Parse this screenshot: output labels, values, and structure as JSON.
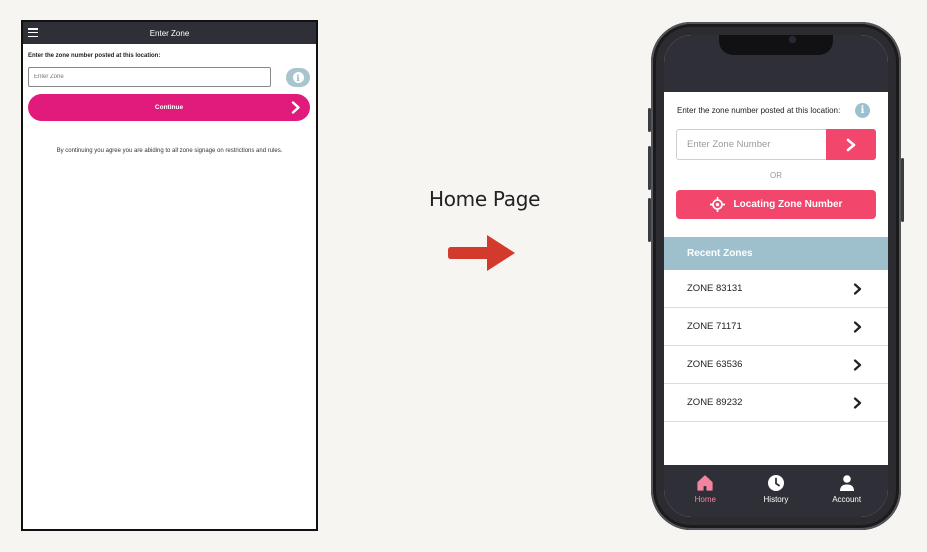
{
  "old_screen": {
    "header_title": "Enter Zone",
    "prompt": "Enter the zone number posted at this location:",
    "input_placeholder": "Enter Zone",
    "continue_label": "Continue",
    "disclaimer": "By continuing you agree you are abiding to all zone signage on restrictions and rules."
  },
  "transition": {
    "label": "Home Page",
    "arrow_color": "#d23a2b"
  },
  "new_screen": {
    "prompt": "Enter the zone number posted at this location:",
    "input_placeholder": "Enter Zone Number",
    "or_label": "OR",
    "locate_label": "Locating Zone Number",
    "recent_header": "Recent Zones",
    "zones": [
      {
        "label": "ZONE 83131"
      },
      {
        "label": "ZONE 71171"
      },
      {
        "label": "ZONE 63536"
      },
      {
        "label": "ZONE 89232"
      }
    ],
    "tabs": [
      {
        "label": "Home",
        "icon": "home-icon"
      },
      {
        "label": "History",
        "icon": "clock-icon"
      },
      {
        "label": "Account",
        "icon": "user-icon"
      }
    ],
    "accent_color": "#f2466d",
    "header_color": "#2f2f37"
  }
}
